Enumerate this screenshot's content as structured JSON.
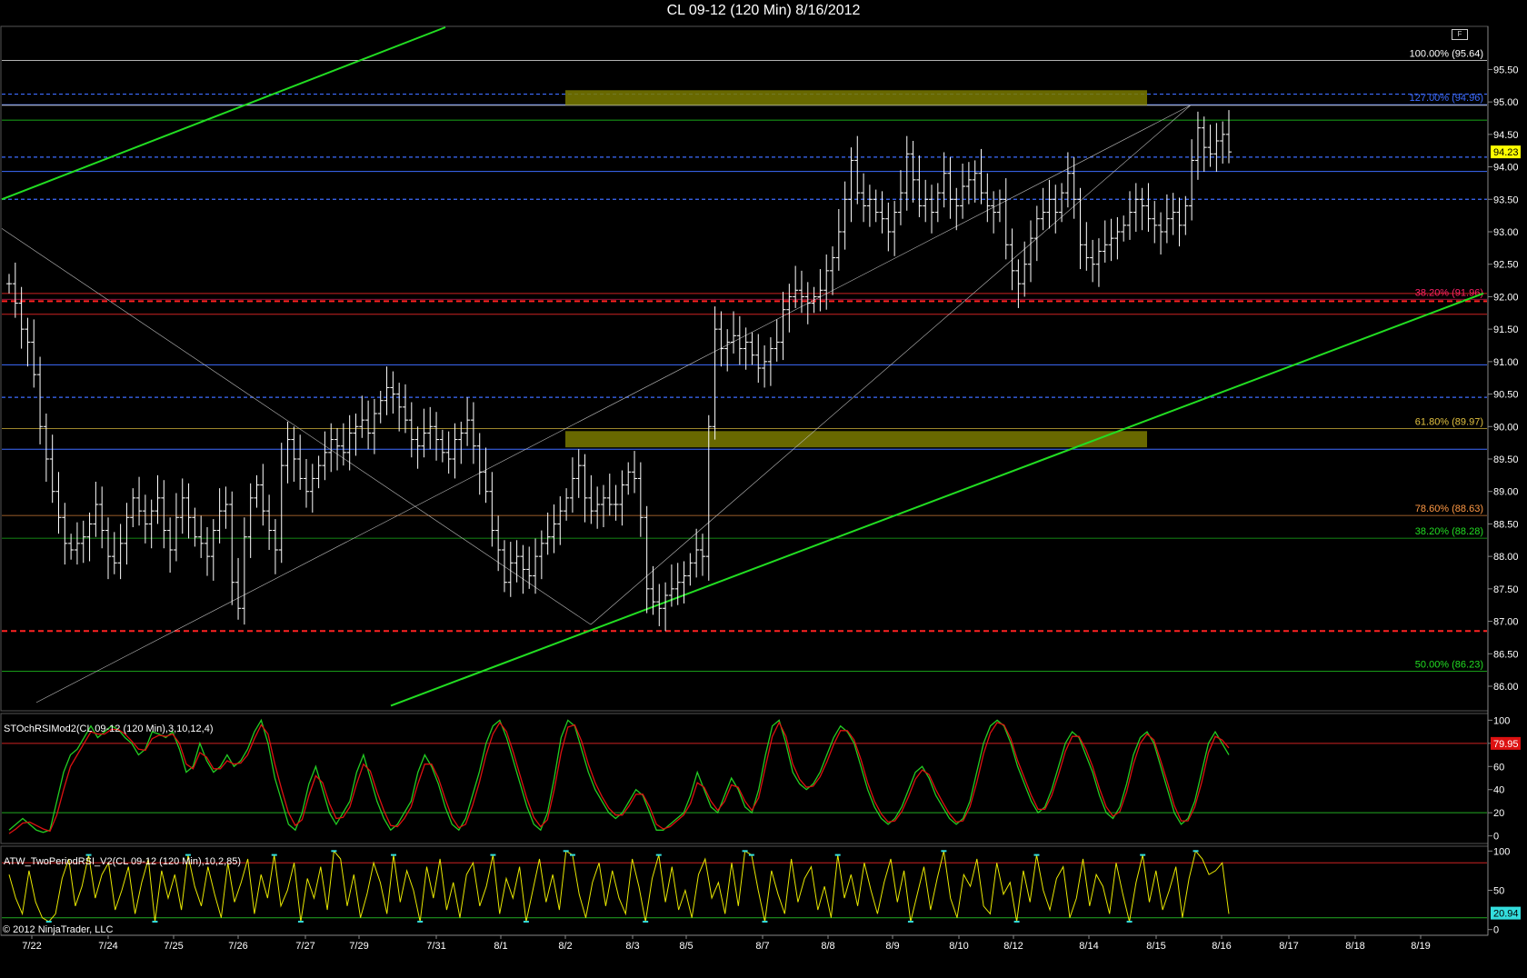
{
  "title": "CL 09-12 (120 Min)  8/16/2012",
  "copyright": "© 2012 NinjaTrader, LLC",
  "corner_button": "F",
  "colors": {
    "background": "#000000",
    "price_bar": "#ffffff",
    "trendline": "#22dd22",
    "fib_red": "#ff2222",
    "fib_blue": "#3d6cff",
    "zone": "#7a7a00",
    "stoch_k": "#22cc22",
    "stoch_d": "#dd1111",
    "rsi_line": "#e8e800",
    "rsi_extreme": "#33dddd",
    "last_price_badge": "#ffff00",
    "stoch_badge": "#dd1111",
    "rsi_badge": "#33dddd"
  },
  "chart_data": [
    {
      "type": "ohlc",
      "title": "CL 09-12 (120 Min)  8/16/2012",
      "y_axis": {
        "range": [
          85.65,
          96.15
        ],
        "ticks": [
          "86.00",
          "86.50",
          "87.00",
          "87.50",
          "88.00",
          "88.50",
          "89.00",
          "89.50",
          "90.00",
          "90.50",
          "91.00",
          "91.50",
          "92.00",
          "92.50",
          "93.00",
          "93.50",
          "94.00",
          "94.50",
          "95.00",
          "95.50"
        ]
      },
      "x_axis": {
        "tick_labels": [
          "7/22",
          "7/24",
          "7/25",
          "7/26",
          "7/27",
          "7/29",
          "7/31",
          "8/1",
          "8/2",
          "8/3",
          "8/5",
          "8/7",
          "8/8",
          "8/9",
          "8/10",
          "8/12",
          "8/14",
          "8/15",
          "8/16",
          "8/17",
          "8/18",
          "8/19"
        ]
      },
      "last_price": "94.23",
      "fib_levels": [
        {
          "label": "100.00% (95.64)",
          "value": 95.64,
          "color": "#ffffff"
        },
        {
          "label": "127.00% (94.96)",
          "value": 94.96,
          "color": "#3d6cff"
        },
        {
          "label": "38.20% (91.96)",
          "value": 91.96,
          "color": "#ff2266"
        },
        {
          "label": "61.80% (89.97)",
          "value": 89.97,
          "color": "#e0c040"
        },
        {
          "label": "78.60% (88.63)",
          "value": 88.63,
          "color": "#ff9944"
        },
        {
          "label": "38.20% (88.28)",
          "value": 88.28,
          "color": "#22dd22"
        },
        {
          "label": "50.00% (86.23)",
          "value": 86.23,
          "color": "#22dd22"
        }
      ],
      "support_resistance_lines": [
        {
          "value": 95.12,
          "style": "blue-dashed"
        },
        {
          "value": 94.95,
          "style": "white"
        },
        {
          "value": 94.72,
          "style": "green"
        },
        {
          "value": 94.15,
          "style": "blue-dashed"
        },
        {
          "value": 93.93,
          "style": "blue"
        },
        {
          "value": 93.5,
          "style": "blue-dashed"
        },
        {
          "value": 92.05,
          "style": "red"
        },
        {
          "value": 91.93,
          "style": "red-dashed"
        },
        {
          "value": 91.73,
          "style": "red"
        },
        {
          "value": 90.95,
          "style": "blue"
        },
        {
          "value": 90.45,
          "style": "blue-dashed"
        },
        {
          "value": 89.65,
          "style": "blue"
        },
        {
          "value": 86.85,
          "style": "red-dashed"
        }
      ],
      "zones": [
        {
          "from_date": "8/2",
          "to_date": "8/15",
          "y_low": 94.95,
          "y_high": 95.18
        },
        {
          "from_date": "8/2",
          "to_date": "8/15",
          "y_low": 89.68,
          "y_high": 89.93
        }
      ],
      "bars": [
        92.2,
        91.9,
        91.5,
        91.3,
        90.8,
        90.0,
        89.5,
        89.0,
        88.6,
        88.2,
        88.1,
        88.2,
        88.3,
        88.5,
        88.8,
        88.4,
        88.0,
        87.9,
        88.2,
        88.6,
        88.9,
        88.7,
        88.5,
        88.7,
        88.9,
        88.4,
        88.1,
        88.6,
        88.9,
        88.6,
        88.3,
        88.2,
        88.0,
        88.4,
        88.7,
        88.8,
        87.6,
        87.2,
        88.3,
        88.9,
        89.1,
        88.7,
        88.4,
        88.1,
        89.4,
        89.8,
        89.5,
        89.2,
        89.0,
        89.2,
        89.4,
        89.6,
        89.8,
        89.7,
        89.6,
        89.9,
        90.0,
        90.1,
        89.9,
        90.2,
        90.4,
        90.6,
        90.5,
        90.3,
        90.1,
        89.8,
        89.7,
        89.9,
        90.0,
        89.8,
        89.6,
        89.5,
        89.8,
        89.9,
        90.1,
        89.7,
        89.3,
        89.0,
        88.4,
        88.1,
        87.6,
        87.9,
        88.0,
        87.8,
        87.7,
        88.0,
        88.2,
        88.3,
        88.5,
        88.7,
        88.9,
        89.2,
        89.4,
        88.9,
        88.7,
        88.8,
        88.9,
        88.8,
        88.8,
        89.1,
        89.3,
        89.2,
        88.6,
        87.5,
        87.3,
        87.2,
        87.4,
        87.5,
        87.6,
        87.7,
        87.9,
        88.1,
        88.0,
        90.0,
        91.5,
        91.2,
        91.3,
        91.4,
        91.2,
        91.3,
        91.1,
        90.9,
        91.0,
        91.2,
        91.3,
        91.8,
        92.0,
        92.1,
        92.0,
        91.9,
        92.0,
        92.1,
        92.4,
        92.6,
        93.0,
        93.5,
        94.1,
        93.6,
        93.4,
        93.5,
        93.3,
        93.2,
        93.0,
        93.3,
        93.6,
        94.2,
        93.8,
        93.4,
        93.5,
        93.3,
        93.6,
        93.9,
        93.5,
        93.4,
        93.7,
        93.8,
        93.9,
        93.6,
        93.4,
        93.3,
        93.5,
        92.8,
        92.4,
        92.2,
        92.5,
        92.9,
        93.2,
        93.3,
        93.5,
        93.3,
        93.6,
        93.9,
        93.5,
        92.8,
        92.6,
        92.5,
        92.7,
        92.8,
        92.9,
        93.0,
        93.1,
        93.3,
        93.5,
        93.4,
        93.2,
        93.1,
        93.0,
        93.2,
        93.3,
        93.1,
        93.4,
        94.1,
        94.6,
        94.3,
        94.2,
        94.4,
        94.5,
        94.23
      ]
    },
    {
      "type": "line",
      "title": "STOchRSIMod2(CL 09-12 (120 Min),3,10,12,4)",
      "y_axis": {
        "range": [
          -5,
          105
        ],
        "ticks": [
          "0",
          "20",
          "40",
          "60",
          "80",
          "100"
        ]
      },
      "reference_lines": [
        20,
        80
      ],
      "last_value": "79.95",
      "series": [
        {
          "name": "",
          "color": "#22cc22",
          "values": [
            5,
            10,
            15,
            10,
            5,
            3,
            5,
            30,
            55,
            70,
            75,
            85,
            95,
            85,
            90,
            95,
            92,
            85,
            80,
            70,
            75,
            90,
            88,
            85,
            90,
            75,
            55,
            60,
            80,
            65,
            55,
            60,
            70,
            60,
            65,
            75,
            90,
            100,
            80,
            50,
            30,
            10,
            5,
            20,
            45,
            60,
            40,
            20,
            10,
            20,
            30,
            55,
            70,
            50,
            30,
            15,
            5,
            10,
            20,
            30,
            55,
            70,
            60,
            45,
            25,
            10,
            5,
            15,
            35,
            55,
            80,
            95,
            100,
            85,
            65,
            45,
            25,
            10,
            5,
            20,
            50,
            85,
            100,
            95,
            75,
            55,
            40,
            30,
            20,
            15,
            20,
            30,
            40,
            35,
            20,
            5,
            5,
            10,
            15,
            20,
            35,
            55,
            40,
            25,
            20,
            35,
            50,
            40,
            25,
            20,
            40,
            70,
            95,
            100,
            80,
            55,
            45,
            40,
            45,
            55,
            70,
            85,
            95,
            90,
            80,
            60,
            40,
            25,
            15,
            10,
            15,
            25,
            40,
            55,
            60,
            50,
            35,
            25,
            15,
            10,
            15,
            30,
            55,
            80,
            95,
            100,
            95,
            80,
            60,
            45,
            30,
            20,
            25,
            40,
            60,
            80,
            90,
            85,
            70,
            55,
            35,
            20,
            15,
            25,
            45,
            70,
            85,
            90,
            80,
            60,
            40,
            20,
            10,
            15,
            30,
            55,
            80,
            90,
            80,
            70
          ]
        },
        {
          "name": "",
          "color": "#dd1111",
          "values": [
            2,
            6,
            11,
            12,
            9,
            6,
            4,
            18,
            40,
            60,
            70,
            80,
            90,
            88,
            88,
            92,
            92,
            88,
            82,
            75,
            74,
            84,
            87,
            86,
            88,
            80,
            62,
            58,
            72,
            68,
            58,
            58,
            65,
            62,
            63,
            70,
            84,
            96,
            88,
            62,
            40,
            20,
            9,
            14,
            35,
            52,
            46,
            28,
            15,
            16,
            25,
            45,
            62,
            56,
            38,
            22,
            9,
            8,
            15,
            25,
            45,
            62,
            62,
            50,
            32,
            16,
            7,
            10,
            26,
            46,
            70,
            88,
            98,
            90,
            72,
            52,
            32,
            16,
            8,
            14,
            40,
            72,
            94,
            96,
            82,
            62,
            46,
            34,
            24,
            18,
            18,
            26,
            36,
            36,
            25,
            10,
            6,
            8,
            13,
            18,
            28,
            46,
            42,
            30,
            22,
            30,
            44,
            42,
            30,
            22,
            33,
            60,
            86,
            98,
            86,
            62,
            49,
            42,
            43,
            51,
            64,
            79,
            91,
            91,
            83,
            66,
            46,
            30,
            19,
            12,
            13,
            21,
            34,
            49,
            57,
            53,
            40,
            29,
            19,
            12,
            13,
            25,
            46,
            71,
            89,
            98,
            96,
            84,
            65,
            50,
            35,
            23,
            23,
            35,
            53,
            73,
            86,
            86,
            75,
            60,
            41,
            25,
            17,
            21,
            38,
            62,
            80,
            88,
            83,
            65,
            46,
            26,
            13,
            13,
            25,
            46,
            72,
            86,
            83,
            76
          ]
        }
      ]
    },
    {
      "type": "line",
      "title": "ATW_TwoPeriodRSI_V2(CL 09-12 (120 Min),10,2,85)",
      "y_axis": {
        "range": [
          -5,
          105
        ],
        "ticks": [
          "0",
          "50",
          "100"
        ]
      },
      "reference_lines": [
        15,
        85
      ],
      "last_value": "20.94",
      "series": [
        {
          "name": "",
          "color": "#e8e800",
          "values": [
            70,
            40,
            20,
            75,
            35,
            15,
            10,
            20,
            65,
            90,
            30,
            55,
            95,
            40,
            70,
            85,
            25,
            50,
            80,
            20,
            60,
            90,
            10,
            75,
            40,
            70,
            25,
            95,
            55,
            30,
            80,
            45,
            15,
            85,
            35,
            60,
            90,
            20,
            70,
            40,
            95,
            30,
            50,
            85,
            10,
            65,
            40,
            80,
            25,
            100,
            90,
            30,
            70,
            15,
            45,
            85,
            60,
            20,
            95,
            35,
            75,
            50,
            10,
            80,
            40,
            90,
            25,
            60,
            15,
            70,
            85,
            30,
            55,
            95,
            20,
            65,
            40,
            80,
            10,
            50,
            90,
            35,
            70,
            25,
            100,
            95,
            45,
            15,
            60,
            85,
            30,
            75,
            40,
            20,
            90,
            55,
            10,
            65,
            95,
            35,
            80,
            25,
            50,
            15,
            70,
            90,
            40,
            60,
            20,
            85,
            30,
            100,
            95,
            50,
            10,
            75,
            45,
            20,
            90,
            35,
            65,
            80,
            25,
            55,
            15,
            95,
            40,
            70,
            30,
            85,
            50,
            20,
            60,
            90,
            35,
            75,
            10,
            45,
            80,
            25,
            65,
            100,
            40,
            15,
            70,
            55,
            90,
            30,
            20,
            85,
            45,
            60,
            10,
            75,
            35,
            95,
            50,
            25,
            65,
            80,
            15,
            40,
            90,
            30,
            70,
            55,
            20,
            85,
            45,
            10,
            60,
            95,
            35,
            75,
            25,
            50,
            80,
            15,
            65,
            100,
            90,
            70,
            75,
            85,
            20
          ]
        }
      ]
    }
  ]
}
